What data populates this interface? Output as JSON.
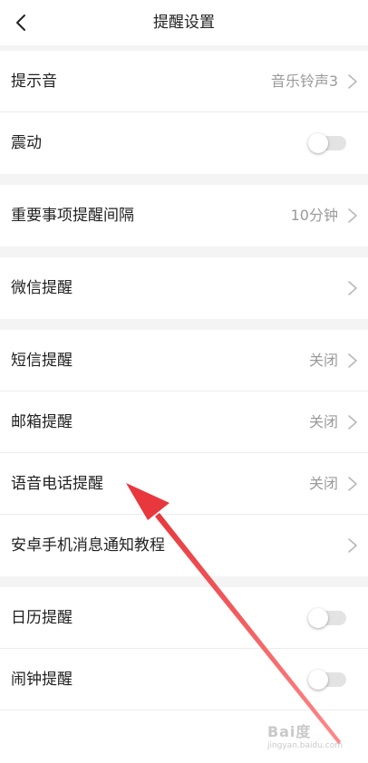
{
  "header": {
    "title": "提醒设置",
    "back_icon": "chevron-left-icon"
  },
  "group1": {
    "sound": {
      "label": "提示音",
      "value": "音乐铃声3"
    },
    "vibrate": {
      "label": "震动",
      "enabled": false
    }
  },
  "group2": {
    "interval": {
      "label": "重要事项提醒间隔",
      "value": "10分钟"
    }
  },
  "group3": {
    "wechat": {
      "label": "微信提醒"
    }
  },
  "group4": {
    "sms": {
      "label": "短信提醒",
      "value": "关闭"
    },
    "email": {
      "label": "邮箱提醒",
      "value": "关闭"
    },
    "voice_call": {
      "label": "语音电话提醒",
      "value": "关闭"
    },
    "android_tutorial": {
      "label": "安卓手机消息通知教程"
    }
  },
  "group5": {
    "calendar": {
      "label": "日历提醒",
      "enabled": false
    },
    "alarm": {
      "label": "闹钟提醒",
      "enabled": false
    }
  },
  "annotation": {
    "arrow_color": "#e8383d"
  },
  "watermark": {
    "text": "Bai度",
    "subtext": "jingyan.baidu.com"
  },
  "colors": {
    "separator": "#f4f4f4",
    "secondary_text": "#9a9a9a",
    "toggle_off": "#e3e3e3"
  }
}
